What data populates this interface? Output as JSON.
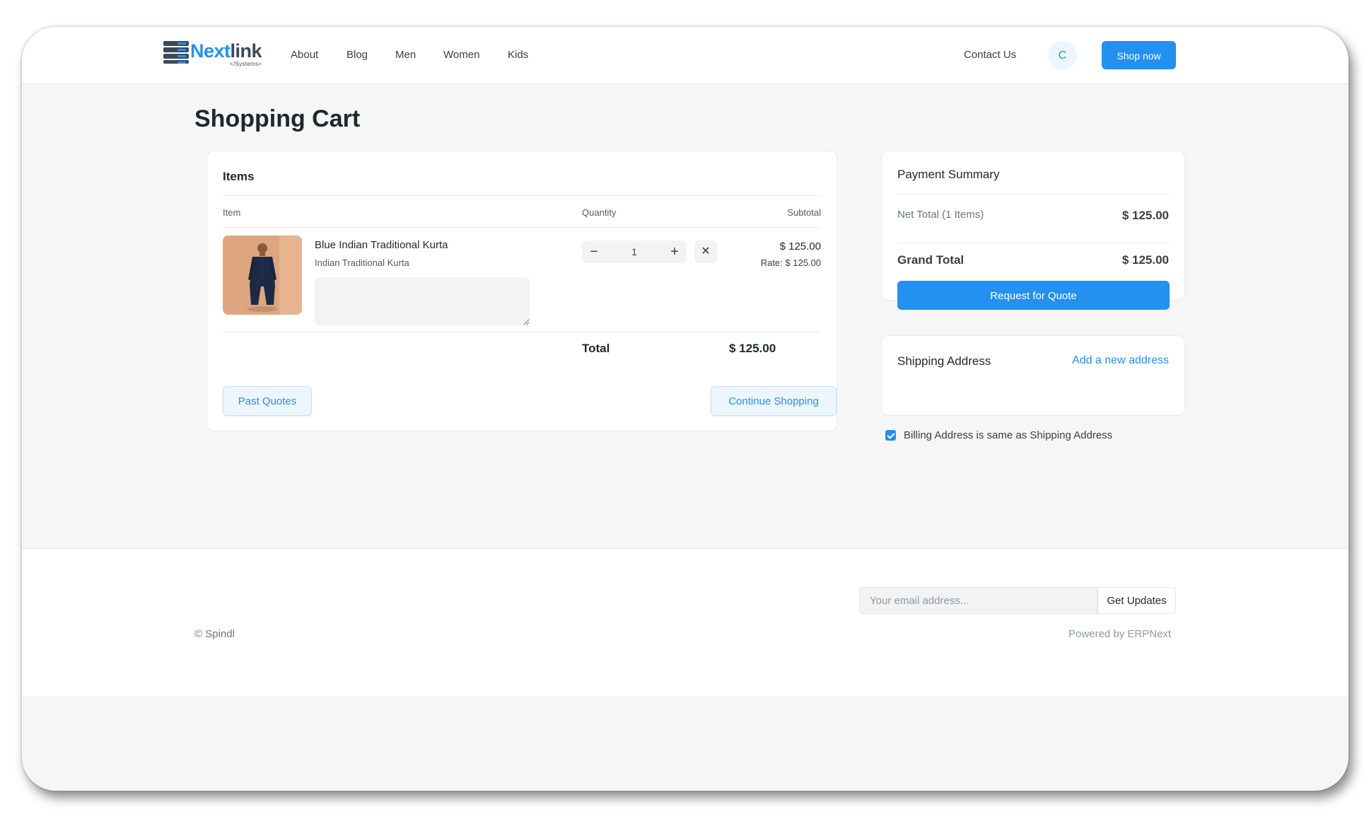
{
  "brand": {
    "name_a": "Next",
    "name_b": "link",
    "sub": "</Systems>"
  },
  "nav": {
    "links": [
      "About",
      "Blog",
      "Men",
      "Women",
      "Kids"
    ],
    "contact": "Contact Us",
    "avatar_initial": "C",
    "cta": "Shop now"
  },
  "page": {
    "title": "Shopping Cart"
  },
  "items_card": {
    "title": "Items",
    "columns": {
      "item": "Item",
      "quantity": "Quantity",
      "subtotal": "Subtotal"
    },
    "items": [
      {
        "name": "Blue Indian Traditional Kurta",
        "description": "Indian Traditional Kurta",
        "quantity": "1",
        "subtotal": "$ 125.00",
        "rate": "Rate: $ 125.00"
      }
    ],
    "total_label": "Total",
    "total_value": "$ 125.00",
    "past_quotes": "Past Quotes",
    "continue_shopping": "Continue Shopping"
  },
  "payment_summary": {
    "title": "Payment Summary",
    "net_total_label": "Net Total (1 Items)",
    "net_total_value": "$ 125.00",
    "grand_total_label": "Grand Total",
    "grand_total_value": "$ 125.00",
    "request_quote": "Request for Quote"
  },
  "shipping": {
    "title": "Shipping Address",
    "add_link": "Add a new address",
    "billing_same": "Billing Address is same as Shipping Address",
    "billing_same_checked": true
  },
  "footer": {
    "email_placeholder": "Your email address...",
    "subscribe": "Get Updates",
    "copyright": "© Spindl",
    "powered_prefix": "Powered by ",
    "powered_link": "ERPNext"
  },
  "colors": {
    "accent": "#2490ef",
    "text": "#1f272e",
    "page_bg": "#f5f6f5"
  },
  "icons": {
    "qty_minus": "minus-icon",
    "qty_plus": "plus-icon",
    "remove": "close-icon",
    "checkbox": "check-icon"
  }
}
